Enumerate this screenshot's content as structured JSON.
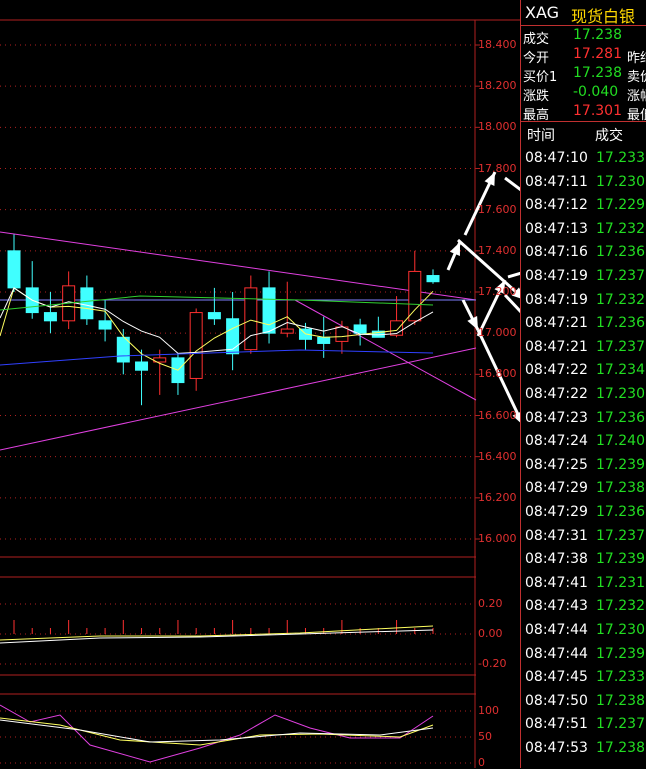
{
  "chart": {
    "y_ticks": [
      "18.400",
      "18.200",
      "18.000",
      "17.800",
      "17.600",
      "17.400",
      "17.200",
      "17.000",
      "16.800",
      "16.600",
      "16.400",
      "16.200",
      "16.000"
    ],
    "sub1_ticks": [
      "0.20",
      "0.00",
      "-0.20"
    ],
    "sub2_ticks": [
      "100",
      "50",
      "0"
    ],
    "colors": {
      "up": "#ff3030",
      "down": "#40ffff",
      "ma_yellow": "#ffff60",
      "ma_green": "#30d030",
      "ma_blue": "#3040ff",
      "trendline": "#e040e0",
      "grid": "#b02020"
    },
    "candles": [
      {
        "o": 17.4,
        "h": 17.48,
        "l": 17.2,
        "c": 17.22
      },
      {
        "o": 17.22,
        "h": 17.35,
        "l": 17.07,
        "c": 17.1
      },
      {
        "o": 17.1,
        "h": 17.2,
        "l": 17.0,
        "c": 17.06
      },
      {
        "o": 17.06,
        "h": 17.3,
        "l": 17.02,
        "c": 17.23
      },
      {
        "o": 17.22,
        "h": 17.28,
        "l": 17.04,
        "c": 17.07
      },
      {
        "o": 17.06,
        "h": 17.16,
        "l": 16.96,
        "c": 17.02
      },
      {
        "o": 16.98,
        "h": 17.02,
        "l": 16.8,
        "c": 16.86
      },
      {
        "o": 16.86,
        "h": 16.92,
        "l": 16.65,
        "c": 16.82
      },
      {
        "o": 16.86,
        "h": 16.92,
        "l": 16.7,
        "c": 16.88
      },
      {
        "o": 16.88,
        "h": 16.9,
        "l": 16.7,
        "c": 16.76
      },
      {
        "o": 16.78,
        "h": 17.12,
        "l": 16.72,
        "c": 17.1
      },
      {
        "o": 17.1,
        "h": 17.22,
        "l": 17.04,
        "c": 17.07
      },
      {
        "o": 17.07,
        "h": 17.2,
        "l": 16.82,
        "c": 16.9
      },
      {
        "o": 16.92,
        "h": 17.28,
        "l": 16.9,
        "c": 17.22
      },
      {
        "o": 17.22,
        "h": 17.3,
        "l": 16.95,
        "c": 17.0
      },
      {
        "o": 17.0,
        "h": 17.25,
        "l": 16.98,
        "c": 17.02
      },
      {
        "o": 17.02,
        "h": 17.05,
        "l": 16.92,
        "c": 16.97
      },
      {
        "o": 16.98,
        "h": 17.08,
        "l": 16.88,
        "c": 16.95
      },
      {
        "o": 16.96,
        "h": 17.06,
        "l": 16.9,
        "c": 17.03
      },
      {
        "o": 17.04,
        "h": 17.07,
        "l": 16.94,
        "c": 17.0
      },
      {
        "o": 17.01,
        "h": 17.08,
        "l": 16.98,
        "c": 16.98
      },
      {
        "o": 16.99,
        "h": 17.18,
        "l": 16.98,
        "c": 17.06
      },
      {
        "o": 17.06,
        "h": 17.4,
        "l": 17.04,
        "c": 17.3
      },
      {
        "o": 17.28,
        "h": 17.31,
        "l": 17.24,
        "c": 17.25
      }
    ]
  },
  "quote": {
    "symbol": "XAG",
    "name": "现货白银",
    "rows": [
      {
        "label": "成交",
        "value": "17.238",
        "color": "#22dd22",
        "extra": ""
      },
      {
        "label": "今开",
        "value": "17.281",
        "color": "#ff3030",
        "extra": "昨结"
      },
      {
        "label": "买价1",
        "value": "17.238",
        "color": "#22dd22",
        "extra": "卖价"
      },
      {
        "label": "涨跌",
        "value": "-0.040",
        "color": "#22dd22",
        "extra": "涨幅"
      },
      {
        "label": "最高",
        "value": "17.301",
        "color": "#ff3030",
        "extra": "最低"
      }
    ],
    "header_time": "时间",
    "header_price": "成交",
    "ticks": [
      {
        "time": "08:47:10",
        "price": "17.233"
      },
      {
        "time": "08:47:11",
        "price": "17.230"
      },
      {
        "time": "08:47:12",
        "price": "17.229"
      },
      {
        "time": "08:47:13",
        "price": "17.232"
      },
      {
        "time": "08:47:16",
        "price": "17.236"
      },
      {
        "time": "08:47:19",
        "price": "17.237"
      },
      {
        "time": "08:47:19",
        "price": "17.232"
      },
      {
        "time": "08:47:21",
        "price": "17.236"
      },
      {
        "time": "08:47:21",
        "price": "17.237"
      },
      {
        "time": "08:47:22",
        "price": "17.234"
      },
      {
        "time": "08:47:22",
        "price": "17.230"
      },
      {
        "time": "08:47:23",
        "price": "17.236"
      },
      {
        "time": "08:47:24",
        "price": "17.240"
      },
      {
        "time": "08:47:25",
        "price": "17.239"
      },
      {
        "time": "08:47:29",
        "price": "17.238"
      },
      {
        "time": "08:47:29",
        "price": "17.236"
      },
      {
        "time": "08:47:31",
        "price": "17.237"
      },
      {
        "time": "08:47:38",
        "price": "17.239"
      },
      {
        "time": "08:47:41",
        "price": "17.231"
      },
      {
        "time": "08:47:43",
        "price": "17.232"
      },
      {
        "time": "08:47:44",
        "price": "17.230"
      },
      {
        "time": "08:47:44",
        "price": "17.239"
      },
      {
        "time": "08:47:45",
        "price": "17.233"
      },
      {
        "time": "08:47:50",
        "price": "17.238"
      },
      {
        "time": "08:47:51",
        "price": "17.237"
      },
      {
        "time": "08:47:53",
        "price": "17.238"
      }
    ]
  }
}
